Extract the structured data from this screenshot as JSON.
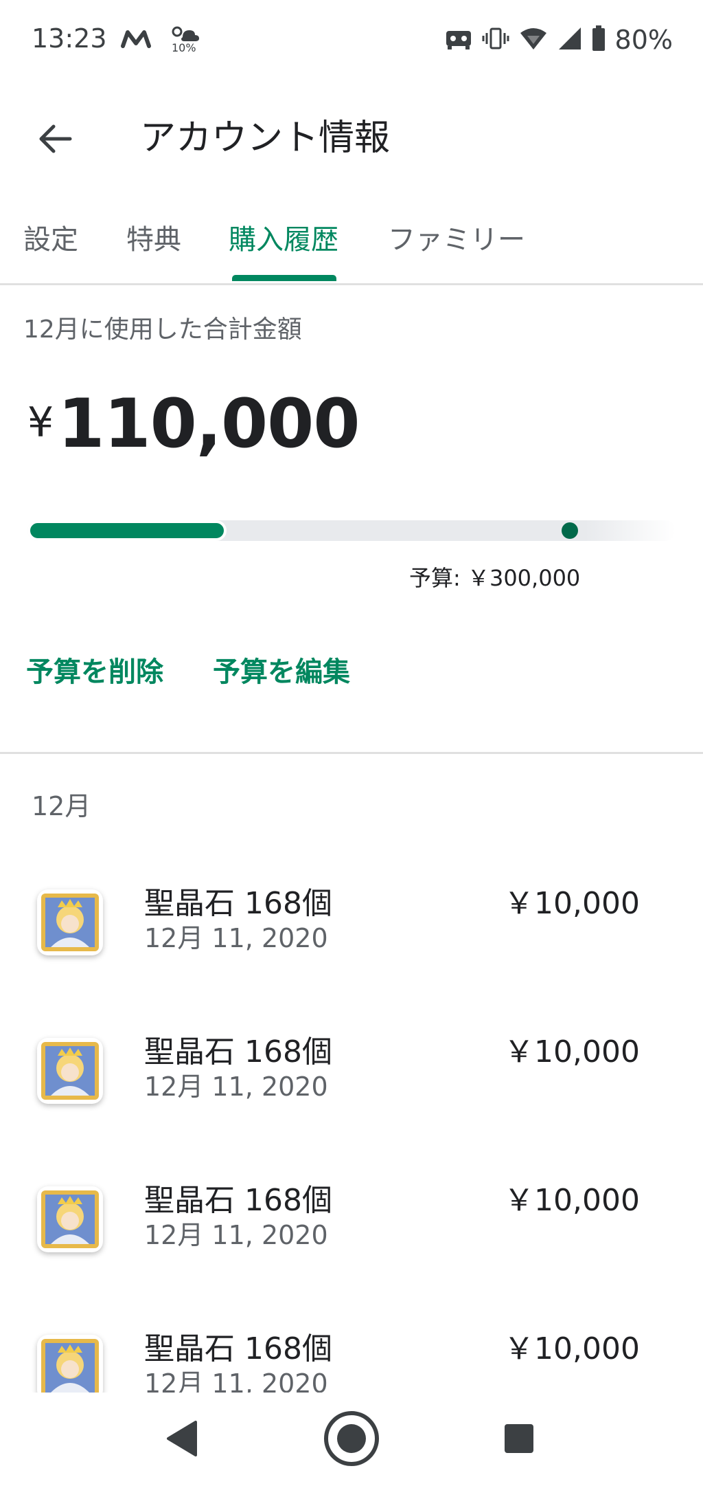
{
  "status_bar": {
    "time": "13:23",
    "weather_percent": "10%",
    "battery_percent": "80%"
  },
  "app_bar": {
    "title": "アカウント情報"
  },
  "tabs": [
    {
      "label": "設定"
    },
    {
      "label": "特典"
    },
    {
      "label": "購入履歴",
      "active": true
    },
    {
      "label": "ファミリー"
    }
  ],
  "summary": {
    "label": "12月に使用した合計金額",
    "currency": "¥",
    "amount": "110,000",
    "budget_caption": "予算: ￥300,000",
    "spent_value": 110000,
    "budget_value": 300000,
    "accent_color": "#01875f"
  },
  "actions": {
    "delete_budget": "予算を削除",
    "edit_budget": "予算を編集"
  },
  "month_header": "12月",
  "purchases": [
    {
      "title": "聖晶石 168個",
      "date": "12月 11, 2020",
      "price": "￥10,000",
      "icon": "fate-go-app-icon"
    },
    {
      "title": "聖晶石 168個",
      "date": "12月 11, 2020",
      "price": "￥10,000",
      "icon": "fate-go-app-icon"
    },
    {
      "title": "聖晶石 168個",
      "date": "12月 11, 2020",
      "price": "￥10,000",
      "icon": "fate-go-app-icon"
    },
    {
      "title": "聖晶石 168個",
      "date": "12月 11, 2020",
      "price": "￥10,000",
      "icon": "fate-go-app-icon"
    }
  ],
  "nav": {
    "back": "back-triangle-icon",
    "home": "home-circle-icon",
    "recents": "recents-square-icon"
  }
}
